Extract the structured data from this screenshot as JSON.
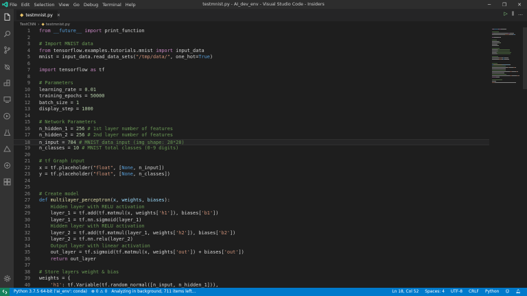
{
  "titlebar": {
    "menu": [
      "File",
      "Edit",
      "Selection",
      "View",
      "Go",
      "Debug",
      "Terminal",
      "Help"
    ],
    "title": "testmnist.py - AI_dev_env - Visual Studio Code - Insiders",
    "buttons": [
      "─",
      "❐",
      "✕"
    ]
  },
  "activity_icons": [
    "files-icon",
    "search-icon",
    "source-control-icon",
    "debug-icon",
    "extensions-icon",
    "remote-icon",
    "docker-icon",
    "test-icon",
    "azure-icon",
    "live-share-icon",
    "database-icon"
  ],
  "tabs": [
    {
      "label": "testmnist.py"
    }
  ],
  "breadcrumbs": [
    "TestCNN",
    "testmnist.py"
  ],
  "run_buttons": [
    "▷",
    "⫼",
    "…"
  ],
  "editor": {
    "current_line": 18,
    "lines": [
      {
        "n": "1",
        "t": [
          [
            "kw2",
            "from"
          ],
          [
            "id",
            " "
          ],
          [
            "kw",
            "__future__"
          ],
          [
            "id",
            " "
          ],
          [
            "kw2",
            "import"
          ],
          [
            "id",
            " print_function"
          ]
        ]
      },
      {
        "n": "2",
        "t": []
      },
      {
        "n": "3",
        "t": [
          [
            "cm",
            "# Import MNIST data"
          ]
        ]
      },
      {
        "n": "4",
        "t": [
          [
            "kw2",
            "from"
          ],
          [
            "id",
            " tensorflow.examples.tutorials.mnist "
          ],
          [
            "kw2",
            "import"
          ],
          [
            "id",
            " input_data"
          ]
        ]
      },
      {
        "n": "5",
        "t": [
          [
            "id",
            "mnist = input_data.read_data_sets("
          ],
          [
            "str",
            "\"/tmp/data/\""
          ],
          [
            "id",
            ", one_hot="
          ],
          [
            "kw",
            "True"
          ],
          [
            "id",
            ")"
          ]
        ]
      },
      {
        "n": "6",
        "t": []
      },
      {
        "n": "7",
        "t": [
          [
            "kw2",
            "import"
          ],
          [
            "id",
            " tensorflow "
          ],
          [
            "kw2",
            "as"
          ],
          [
            "id",
            " tf"
          ]
        ]
      },
      {
        "n": "8",
        "t": []
      },
      {
        "n": "9",
        "t": [
          [
            "cm",
            "# Parameters"
          ]
        ]
      },
      {
        "n": "10",
        "t": [
          [
            "id",
            "learning_rate = "
          ],
          [
            "num",
            "0.01"
          ]
        ]
      },
      {
        "n": "11",
        "t": [
          [
            "id",
            "training_epochs = "
          ],
          [
            "num",
            "50000"
          ]
        ]
      },
      {
        "n": "12",
        "t": [
          [
            "id",
            "batch_size = "
          ],
          [
            "num",
            "1"
          ]
        ]
      },
      {
        "n": "13",
        "t": [
          [
            "id",
            "display_step = "
          ],
          [
            "num",
            "1000"
          ]
        ]
      },
      {
        "n": "14",
        "t": []
      },
      {
        "n": "15",
        "t": [
          [
            "cm",
            "# Network Parameters"
          ]
        ]
      },
      {
        "n": "16",
        "t": [
          [
            "id",
            "n_hidden_1 = "
          ],
          [
            "num",
            "256"
          ],
          [
            "cm",
            " # 1st layer number of features"
          ]
        ]
      },
      {
        "n": "17",
        "t": [
          [
            "id",
            "n_hidden_2 = "
          ],
          [
            "num",
            "256"
          ],
          [
            "cm",
            " # 2nd layer number of features"
          ]
        ]
      },
      {
        "n": "18",
        "t": [
          [
            "id",
            "n_input = "
          ],
          [
            "num",
            "784"
          ],
          [
            "cm",
            " # MNIST data input (img shape: 28*28)"
          ]
        ]
      },
      {
        "n": "19",
        "t": [
          [
            "id",
            "n_classes = "
          ],
          [
            "num",
            "10"
          ],
          [
            "cm",
            " # MNIST total classes (0-9 digits)"
          ]
        ]
      },
      {
        "n": "20",
        "t": []
      },
      {
        "n": "21",
        "t": [
          [
            "cm",
            "# tf Graph input"
          ]
        ]
      },
      {
        "n": "22",
        "t": [
          [
            "id",
            "x = tf.placeholder("
          ],
          [
            "str",
            "\"float\""
          ],
          [
            "id",
            ", ["
          ],
          [
            "kw",
            "None"
          ],
          [
            "id",
            ", n_input])"
          ]
        ]
      },
      {
        "n": "23",
        "t": [
          [
            "id",
            "y = tf.placeholder("
          ],
          [
            "str",
            "\"float\""
          ],
          [
            "id",
            ", ["
          ],
          [
            "kw",
            "None"
          ],
          [
            "id",
            ", n_classes])"
          ]
        ]
      },
      {
        "n": "24",
        "t": []
      },
      {
        "n": "25",
        "t": []
      },
      {
        "n": "26",
        "t": [
          [
            "cm",
            "# Create model"
          ]
        ]
      },
      {
        "n": "27",
        "t": [
          [
            "kw",
            "def"
          ],
          [
            "id",
            " "
          ],
          [
            "fn",
            "multilayer_perceptron"
          ],
          [
            "id",
            "("
          ],
          [
            "prm",
            "x"
          ],
          [
            "id",
            ", "
          ],
          [
            "prm",
            "weights"
          ],
          [
            "id",
            ", "
          ],
          [
            "prm",
            "biases"
          ],
          [
            "id",
            "):"
          ]
        ]
      },
      {
        "n": "28",
        "t": [
          [
            "cm",
            "    Hidden layer with RELU activation"
          ]
        ]
      },
      {
        "n": "29",
        "t": [
          [
            "id",
            "    layer_1 = tf.add(tf.matmul(x, weights["
          ],
          [
            "str",
            "'h1'"
          ],
          [
            "id",
            "]), biases["
          ],
          [
            "str",
            "'b1'"
          ],
          [
            "id",
            "])"
          ]
        ]
      },
      {
        "n": "30",
        "t": [
          [
            "id",
            "    layer_1 = tf.nn.sigmoid(layer_1)"
          ]
        ]
      },
      {
        "n": "31",
        "t": [
          [
            "cm",
            "    Hidden layer with RELU activation"
          ]
        ]
      },
      {
        "n": "32",
        "t": [
          [
            "id",
            "    layer_2 = tf.add(tf.matmul(layer_1, weights["
          ],
          [
            "str",
            "'h2'"
          ],
          [
            "id",
            "]), biases["
          ],
          [
            "str",
            "'b2'"
          ],
          [
            "id",
            "])"
          ]
        ]
      },
      {
        "n": "33",
        "t": [
          [
            "id",
            "    layer_2 = tf.nn.relu(layer_2)"
          ]
        ]
      },
      {
        "n": "34",
        "t": [
          [
            "cm",
            "    Output layer with linear activation"
          ]
        ]
      },
      {
        "n": "35",
        "t": [
          [
            "id",
            "    out_layer = tf.sigmoid(tf.matmul(x, weights["
          ],
          [
            "str",
            "'out'"
          ],
          [
            "id",
            "]) + biases["
          ],
          [
            "str",
            "'out'"
          ],
          [
            "id",
            "])"
          ]
        ]
      },
      {
        "n": "36",
        "t": [
          [
            "kw2",
            "    return"
          ],
          [
            "id",
            " out_layer"
          ]
        ]
      },
      {
        "n": "37",
        "t": []
      },
      {
        "n": "38",
        "t": [
          [
            "cm",
            "# Store layers weight & bias"
          ]
        ]
      },
      {
        "n": "39",
        "t": [
          [
            "id",
            "weights = {"
          ]
        ]
      },
      {
        "n": "40",
        "t": [
          [
            "str",
            "    'h1'"
          ],
          [
            "id",
            ": tf.Variable(tf.random_normal([n_input, n_hidden_1])),"
          ]
        ]
      }
    ]
  },
  "status": {
    "python": "Python 3.7.5 64-bit ('ai_env': conda)",
    "problems": "⊗ 0  ⚠ 0",
    "analyzing": "Analyzing in background, 711 items left...",
    "position": "Ln 18, Col 52",
    "spaces": "Spaces: 4",
    "encoding": "UTF-8",
    "eol": "CRLF",
    "language": "Python"
  },
  "colors": {
    "accent": "#007acc",
    "remote": "#16825d",
    "editor_bg": "#1e1e1e"
  }
}
